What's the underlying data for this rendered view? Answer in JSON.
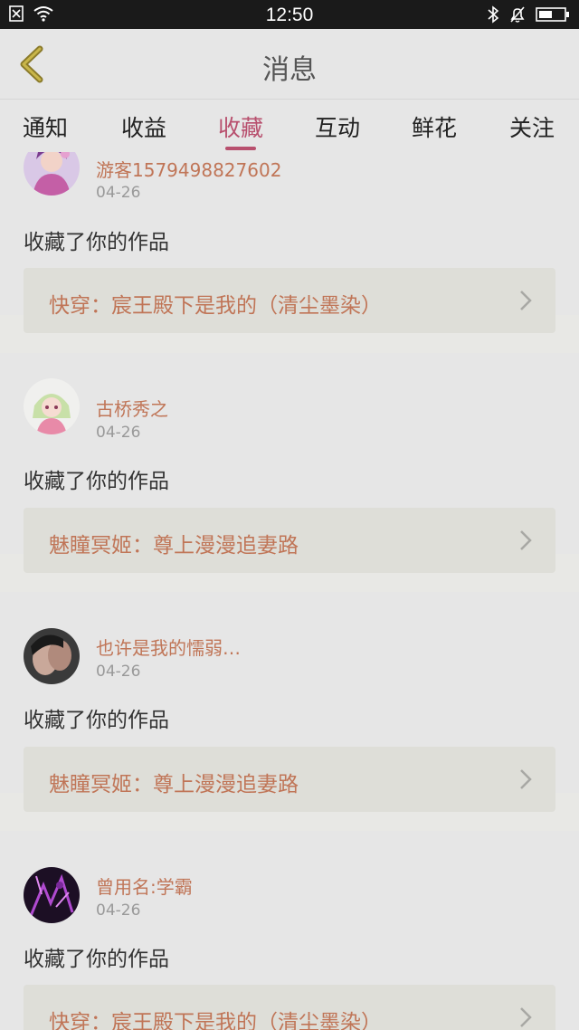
{
  "status_bar": {
    "time": "12:50"
  },
  "header": {
    "title": "消息"
  },
  "tabs": [
    {
      "label": "通知"
    },
    {
      "label": "收益"
    },
    {
      "label": "收藏"
    },
    {
      "label": "互动"
    },
    {
      "label": "鲜花"
    },
    {
      "label": "关注"
    }
  ],
  "active_tab": "收藏",
  "accent_color": "#b8506e",
  "name_color": "#c07557",
  "items": [
    {
      "user": "游客1579498827602",
      "date": "04-26",
      "action": "收藏了你的作品",
      "work": "快穿：宸王殿下是我的（清尘墨染）"
    },
    {
      "user": "古桥秀之",
      "date": "04-26",
      "action": "收藏了你的作品",
      "work": "魅瞳冥姬：尊上漫漫追妻路"
    },
    {
      "user": "也许是我的懦弱…",
      "date": "04-26",
      "action": "收藏了你的作品",
      "work": "魅瞳冥姬：尊上漫漫追妻路"
    },
    {
      "user": "曾用名:学霸",
      "date": "04-26",
      "action": "收藏了你的作品",
      "work": "快穿：宸王殿下是我的（清尘墨染）"
    }
  ]
}
